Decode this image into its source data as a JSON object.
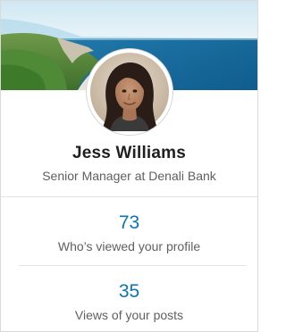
{
  "profile": {
    "name": "Jess Williams",
    "headline": "Senior Manager at Denali Bank"
  },
  "stats": [
    {
      "value": "73",
      "label": "Who’s viewed your profile"
    },
    {
      "value": "35",
      "label": "Views of your posts"
    }
  ],
  "colors": {
    "accent": "#0a74b5",
    "text_primary": "#1f1f1f",
    "text_secondary": "#5f5f5f",
    "divider": "#e3e3e3"
  }
}
